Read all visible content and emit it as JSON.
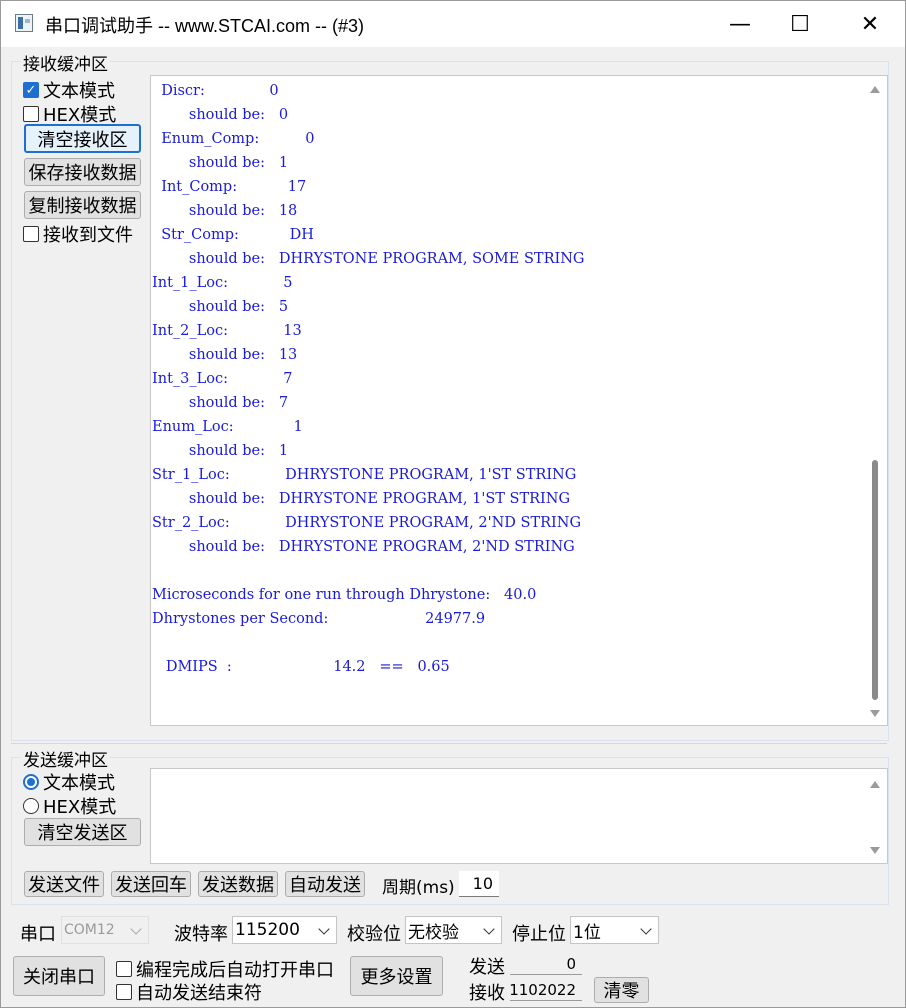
{
  "window": {
    "title": "串口调试助手 -- www.STCAI.com -- (#3)",
    "minimize": "—",
    "maximize": "☐",
    "close": "✕"
  },
  "receive": {
    "group_label": "接收缓冲区",
    "text_mode": {
      "label": "文本模式",
      "checked": true
    },
    "hex_mode": {
      "label": "HEX模式",
      "checked": false
    },
    "clear_button": "清空接收区",
    "save_button": "保存接收数据",
    "copy_button": "复制接收数据",
    "to_file": {
      "label": "接收到文件",
      "checked": false
    },
    "lines": [
      "  Discr:              0",
      "        should be:   0",
      "  Enum_Comp:          0",
      "        should be:   1",
      "  Int_Comp:           17",
      "        should be:   18",
      "  Str_Comp:           DH",
      "        should be:   DHRYSTONE PROGRAM, SOME STRING",
      "Int_1_Loc:            5",
      "        should be:   5",
      "Int_2_Loc:            13",
      "        should be:   13",
      "Int_3_Loc:            7",
      "        should be:   7",
      "Enum_Loc:             1",
      "        should be:   1",
      "Str_1_Loc:            DHRYSTONE PROGRAM, 1'ST STRING",
      "        should be:   DHRYSTONE PROGRAM, 1'ST STRING",
      "Str_2_Loc:            DHRYSTONE PROGRAM, 2'ND STRING",
      "        should be:   DHRYSTONE PROGRAM, 2'ND STRING",
      "",
      "Microseconds for one run through Dhrystone:   40.0",
      "Dhrystones per Second:                     24977.9",
      "",
      "   DMIPS  :                      14.2   ==   0.65"
    ]
  },
  "send": {
    "group_label": "发送缓冲区",
    "text_mode": {
      "label": "文本模式",
      "selected": true
    },
    "hex_mode": {
      "label": "HEX模式",
      "selected": false
    },
    "clear_button": "清空发送区",
    "content": "",
    "send_file_button": "发送文件",
    "send_enter_button": "发送回车",
    "send_data_button": "发送数据",
    "auto_send_button": "自动发送",
    "period_label": "周期(ms)",
    "period_value": "10"
  },
  "port": {
    "port_label": "串口",
    "port_value": "COM12",
    "baud_label": "波特率",
    "baud_value": "115200",
    "parity_label": "校验位",
    "parity_value": "无校验",
    "stop_label": "停止位",
    "stop_value": "1位",
    "close_port_button": "关闭串口",
    "auto_open_label": "编程完成后自动打开串口",
    "auto_send_end_label": "自动发送结束符",
    "more_settings_button": "更多设置",
    "sent_label": "发送",
    "sent_count": "0",
    "recv_label": "接收",
    "recv_count": "1102022",
    "clear_count_button": "清零"
  }
}
